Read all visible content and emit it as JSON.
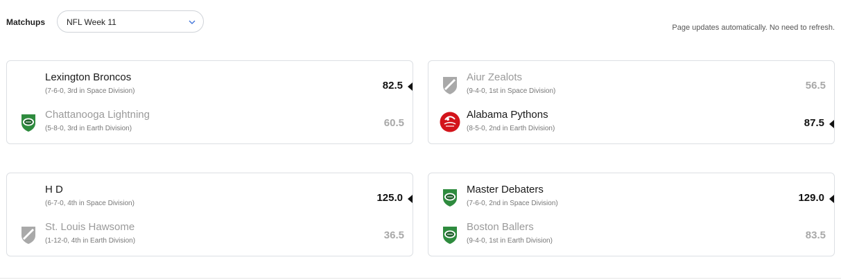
{
  "header": {
    "matchups_label": "Matchups",
    "week_select_value": "NFL Week 11",
    "update_note": "Page updates automatically. No need to refresh."
  },
  "matchups": [
    {
      "team1": {
        "name": "Lexington Broncos",
        "record": "(7-6-0, 3rd in Space Division)",
        "score": "82.5",
        "logo": "none"
      },
      "team2": {
        "name": "Chattanooga Lightning",
        "record": "(5-8-0, 3rd in Earth Division)",
        "score": "60.5",
        "logo": "green-football-shield-icon"
      }
    },
    {
      "team1": {
        "name": "Aiur Zealots",
        "record": "(9-4-0, 1st in Space Division)",
        "score": "56.5",
        "logo": "gray-shield-icon"
      },
      "team2": {
        "name": "Alabama Pythons",
        "record": "(8-5-0, 2nd in Earth Division)",
        "score": "87.5",
        "logo": "pythons-logo-icon"
      }
    },
    {
      "team1": {
        "name": "H D",
        "record": "(6-7-0, 4th in Space Division)",
        "score": "125.0",
        "logo": "none"
      },
      "team2": {
        "name": "St. Louis Hawsome",
        "record": "(1-12-0, 4th in Earth Division)",
        "score": "36.5",
        "logo": "gray-shield-icon"
      }
    },
    {
      "team1": {
        "name": "Master Debaters",
        "record": "(7-6-0, 2nd in Space Division)",
        "score": "129.0",
        "logo": "green-football-shield-icon"
      },
      "team2": {
        "name": "Boston Ballers",
        "record": "(9-4-0, 1st in Earth Division)",
        "score": "83.5",
        "logo": "green-football-shield-icon"
      }
    }
  ],
  "colors": {
    "winner_text": "#111111",
    "loser_text": "#9a9a9a",
    "shield_green": "#2e8b3e",
    "shield_gray": "#9a9a9a",
    "pythons_red": "#d3141b"
  }
}
